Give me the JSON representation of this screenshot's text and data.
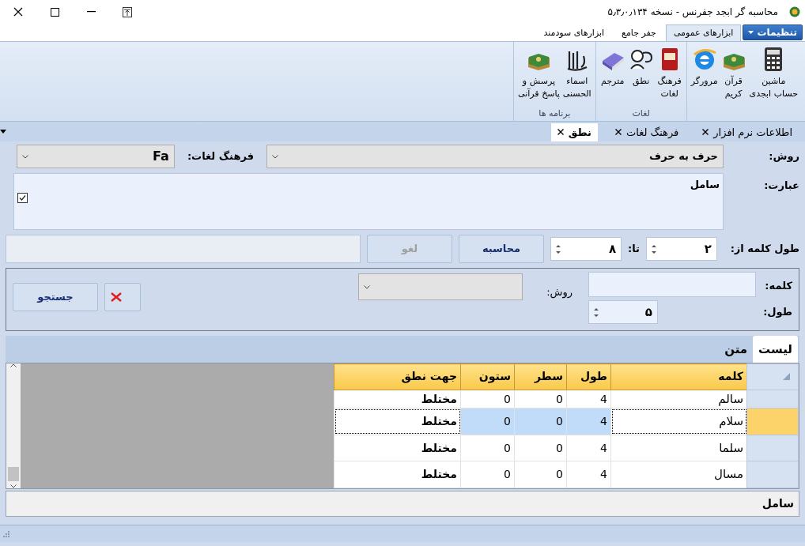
{
  "window": {
    "title": "محاسبه گر ابجد جفرنس - نسخه ۵٫۳٫۰٫۱۳۴"
  },
  "ribbon": {
    "settings_menu": "تنظیمات",
    "tabs": [
      {
        "label": "ابزارهای عمومی",
        "selected": true
      },
      {
        "label": "جفر جامع",
        "selected": false
      },
      {
        "label": "ابزارهای سودمند",
        "selected": false
      }
    ],
    "groups": [
      {
        "items": [
          {
            "kind": "calculator",
            "lines": [
              "ماشین",
              "حساب ابجدی"
            ]
          },
          {
            "kind": "quran",
            "lines": [
              "قرآن",
              "کریم"
            ]
          },
          {
            "kind": "browser",
            "lines": [
              "مرورگر"
            ]
          }
        ]
      },
      {
        "label": "لغات",
        "items": [
          {
            "kind": "dictionary",
            "lines": [
              "فرهنگ",
              "لغات"
            ]
          },
          {
            "kind": "speech",
            "lines": [
              "نطق"
            ]
          },
          {
            "kind": "translator",
            "lines": [
              "مترجم"
            ]
          }
        ]
      },
      {
        "label": "برنامه ها",
        "items": [
          {
            "kind": "calligraphy",
            "lines": [
              "اسماء",
              "الحسنی"
            ]
          },
          {
            "kind": "quran",
            "lines": [
              "پرسش و",
              "پاسخ قرآنی"
            ]
          }
        ]
      }
    ]
  },
  "doc_tabs": [
    {
      "label": "اطلاعات نرم افزار",
      "selected": false
    },
    {
      "label": "فرهنگ لغات",
      "selected": false
    },
    {
      "label": "نطق",
      "selected": true
    }
  ],
  "form": {
    "method_label": "روش:",
    "method_value": "حرف به حرف",
    "dictionary_label": "فرهنگ لغات:",
    "dictionary_value": "Fa",
    "phrase_label": "عبارت:",
    "phrase_value": "سامل",
    "phrase_checked": true,
    "length_from_label": "طول کلمه از:",
    "length_from": "۲",
    "length_to_label": "تا:",
    "length_to": "۸",
    "calculate_button": {
      "label": "محاسبه",
      "disabled": false
    },
    "cancel_button": {
      "label": "لغو",
      "disabled": true
    }
  },
  "search": {
    "word_label": "کلمه:",
    "length_label": "طول:",
    "length_value": "۵",
    "method_label": "روش:",
    "search_button": "جستجو"
  },
  "result_tabs": [
    {
      "label": "لیست",
      "selected": true
    },
    {
      "label": "متن",
      "selected": false
    }
  ],
  "table": {
    "columns": [
      "کلمه",
      "طول",
      "سطر",
      "ستون",
      "جهت نطق"
    ],
    "rows": [
      {
        "cells": [
          "سالم",
          "4",
          "0",
          "0",
          "مختلط"
        ],
        "selected": false
      },
      {
        "cells": [
          "سلام",
          "4",
          "0",
          "0",
          "مختلط"
        ],
        "selected": true
      },
      {
        "cells": [
          "سلما",
          "4",
          "0",
          "0",
          "مختلط"
        ],
        "selected": false
      },
      {
        "cells": [
          "مسال",
          "4",
          "0",
          "0",
          "مختلط"
        ],
        "selected": false
      }
    ]
  },
  "status_text": "سامل"
}
